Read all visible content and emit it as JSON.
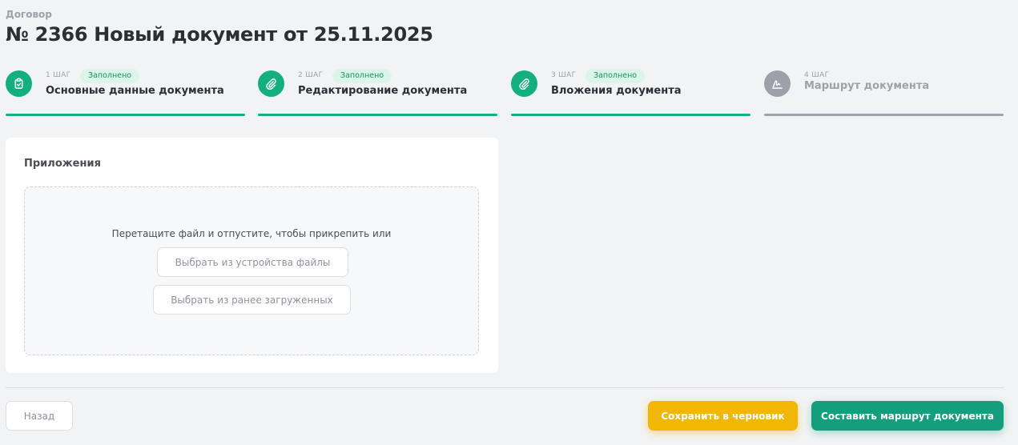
{
  "header": {
    "doc_type": "Договор",
    "title": "№ 2366 Новый документ от 25.11.2025"
  },
  "steps": [
    {
      "number_label": "1 ШАГ",
      "status": "Заполнено",
      "name": "Основные данные документа",
      "icon": "clipboard-icon",
      "state": "done"
    },
    {
      "number_label": "2 ШАГ",
      "status": "Заполнено",
      "name": "Редактирование документа",
      "icon": "paperclip-icon",
      "state": "done"
    },
    {
      "number_label": "3 ШАГ",
      "status": "Заполнено",
      "name": "Вложения документа",
      "icon": "paperclip-icon",
      "state": "done"
    },
    {
      "number_label": "4 ШАГ",
      "status": "",
      "name": "Маршрут документа",
      "icon": "signature-icon",
      "state": "todo"
    }
  ],
  "attachments": {
    "title": "Приложения",
    "drop_hint": "Перетащите файл и отпустите, чтобы прикрепить или",
    "choose_device_label": "Выбрать из устройства файлы",
    "choose_previous_label": "Выбрать из ранее загруженных"
  },
  "footer": {
    "back_label": "Назад",
    "save_draft_label": "Сохранить в черновик",
    "build_route_label": "Составить маршрут документа"
  },
  "colors": {
    "accent_green": "#12b07e",
    "badge_bg": "#dcf5e9",
    "draft_yellow": "#f2b705",
    "route_green": "#139e7d",
    "inactive_gray": "#9da0a8"
  }
}
